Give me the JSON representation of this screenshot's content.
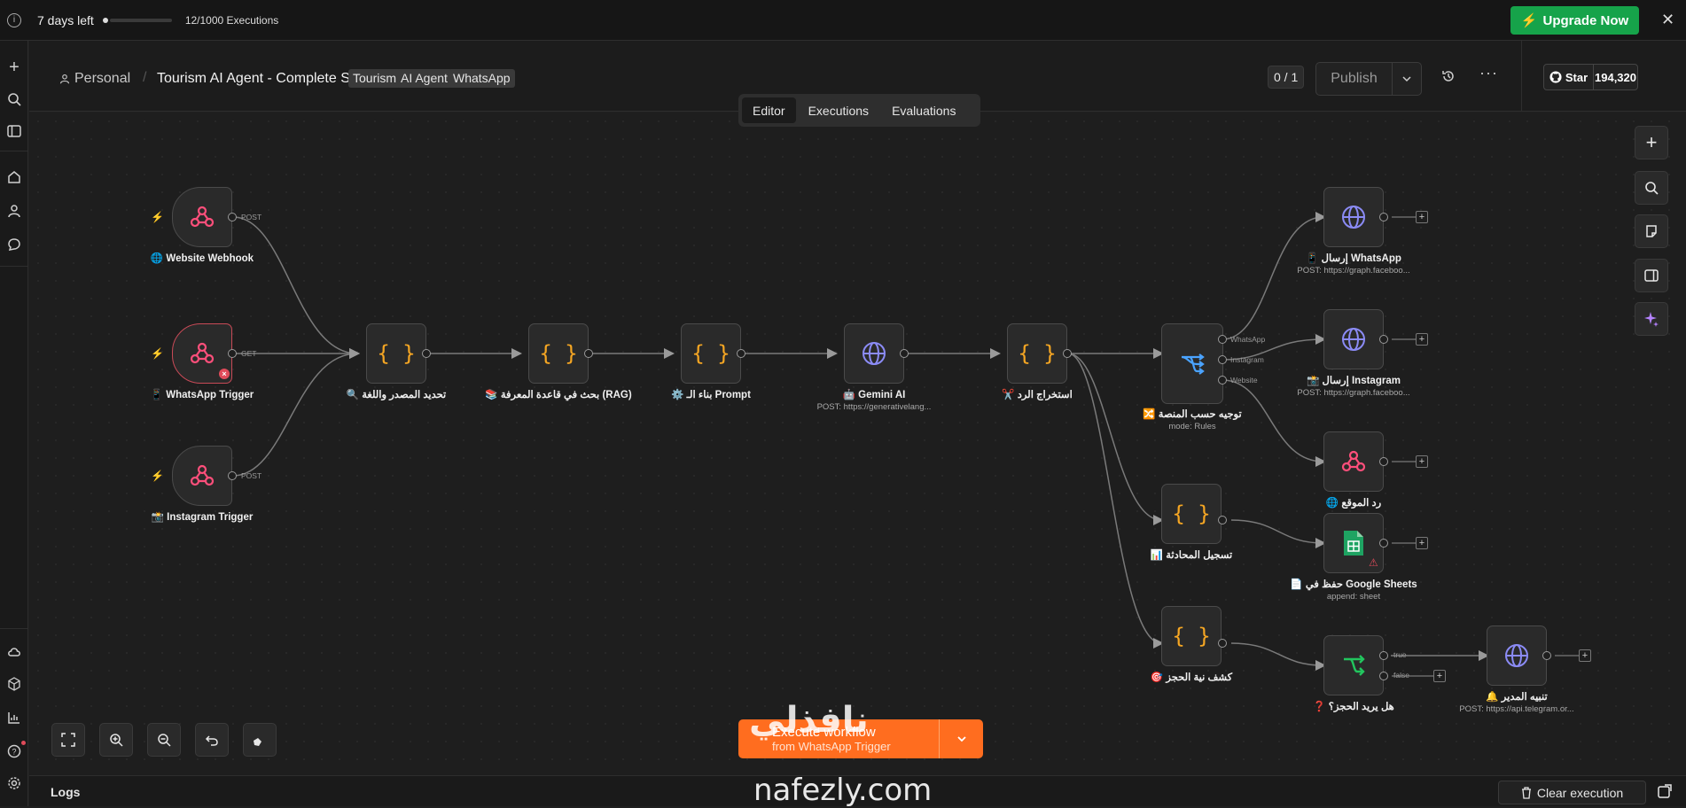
{
  "banner": {
    "days_left": "7 days left",
    "executions": "12/1000 Executions",
    "upgrade_label": "Upgrade Now"
  },
  "header": {
    "project": "Personal",
    "workflow_title": "Tourism AI Agent - Complete System",
    "tags": [
      "Tourism",
      "AI Agent",
      "WhatsApp"
    ],
    "counter": "0 / 1",
    "publish_label": "Publish",
    "star_label": "Star",
    "star_count": "194,320"
  },
  "tabs": [
    "Editor",
    "Executions",
    "Evaluations"
  ],
  "nodes": {
    "website_webhook": {
      "label": "🌐 Website Webhook",
      "port": "POST"
    },
    "whatsapp_trigger": {
      "label": "📱 WhatsApp Trigger",
      "port": "GET"
    },
    "instagram_trigger": {
      "label": "📸 Instagram Trigger",
      "port": "POST"
    },
    "detect_source": {
      "label": "🔍 تحديد المصدر واللغة"
    },
    "rag_search": {
      "label": "📚 بحث في قاعدة المعرفة (RAG)"
    },
    "build_prompt": {
      "label": "⚙️ بناء الـ Prompt"
    },
    "gemini": {
      "label": "🤖 Gemini AI",
      "sub": "POST: https://generativelang..."
    },
    "extract_reply": {
      "label": "✂️ استخراج الرد"
    },
    "route_platform": {
      "label": "🔀 توجيه حسب المنصة",
      "sub": "mode: Rules",
      "ports": [
        "WhatsApp",
        "Instagram",
        "Website"
      ]
    },
    "send_whatsapp": {
      "label": "📱 إرسال WhatsApp",
      "sub": "POST: https://graph.faceboo..."
    },
    "send_instagram": {
      "label": "📸 إرسال Instagram",
      "sub": "POST: https://graph.faceboo..."
    },
    "website_reply": {
      "label": "🌐 رد الموقع"
    },
    "log_conversation": {
      "label": "📊 تسجيل المحادثة"
    },
    "google_sheets": {
      "label": "📄 حفظ في Google Sheets",
      "sub": "append: sheet"
    },
    "detect_booking": {
      "label": "🎯 كشف نية الحجز"
    },
    "wants_booking": {
      "label": "❓ هل يريد الحجز؟",
      "ports": [
        "true",
        "false"
      ]
    },
    "notify_manager": {
      "label": "🔔 تنبيه المدير",
      "sub": "POST: https://api.telegram.or..."
    }
  },
  "execute": {
    "title": "Execute workflow",
    "subtitle": "from WhatsApp Trigger"
  },
  "logs": {
    "label": "Logs",
    "clear_label": "Clear execution"
  },
  "watermark": {
    "text": "nafezly.com",
    "arabic": "نافذلي"
  }
}
